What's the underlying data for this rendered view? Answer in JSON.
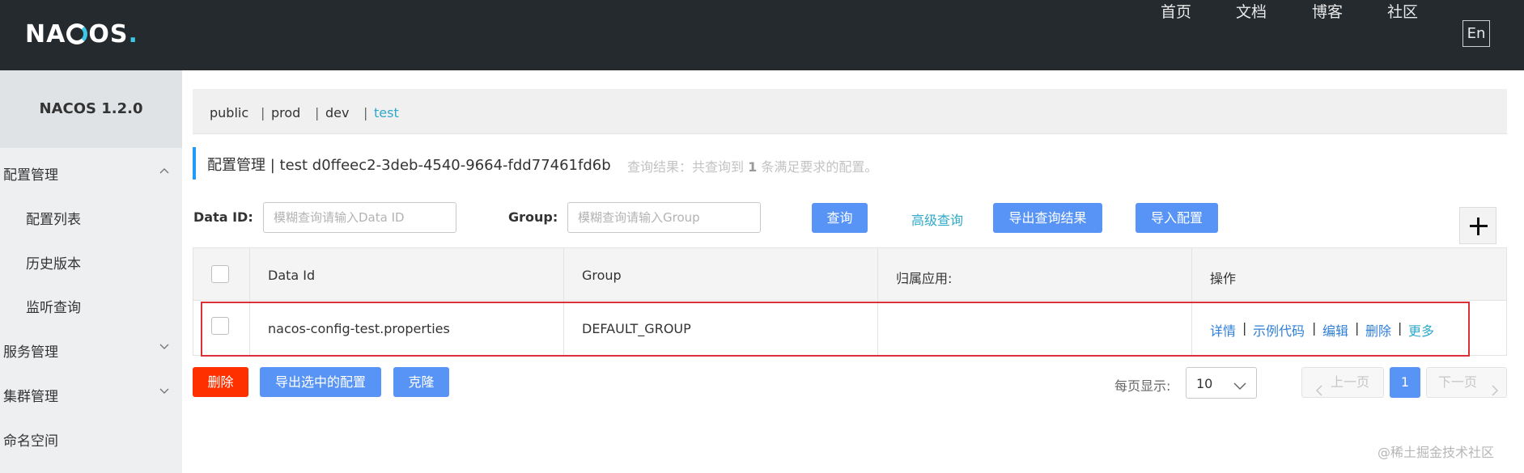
{
  "header": {
    "logo_text_left": "NA",
    "logo_text_right": "OS",
    "logo_dot": ".",
    "nav": [
      "首页",
      "文档",
      "博客",
      "社区"
    ],
    "lang": "En"
  },
  "sidebar": {
    "version": "NACOS 1.2.0",
    "menu": [
      {
        "label": "配置管理"
      },
      {
        "label": "配置列表"
      },
      {
        "label": "历史版本"
      },
      {
        "label": "监听查询"
      },
      {
        "label": "服务管理"
      },
      {
        "label": "集群管理"
      },
      {
        "label": "命名空间"
      }
    ]
  },
  "namespaces": {
    "items": [
      "public",
      "prod",
      "dev",
      "test"
    ],
    "separator": "|",
    "active": "test"
  },
  "title": {
    "text": "配置管理 | test d0ffeec2-3deb-4540-9664-fdd77461fd6b",
    "hint_prefix": "查询结果：共查询到",
    "hint_count": "1",
    "hint_suffix": "条满足要求的配置。"
  },
  "search": {
    "data_id_label": "Data ID:",
    "data_id_placeholder": "模糊查询请输入Data ID",
    "group_label": "Group:",
    "group_placeholder": "模糊查询请输入Group",
    "query_button": "查询",
    "advanced_query": "高级查询",
    "export_results": "导出查询结果",
    "import_config": "导入配置"
  },
  "table": {
    "headers": [
      "Data Id",
      "Group",
      "归属应用:",
      "操作"
    ],
    "rows": [
      {
        "data_id": "nacos-config-test.properties",
        "group": "DEFAULT_GROUP",
        "app": "",
        "actions": [
          "详情",
          "示例代码",
          "编辑",
          "删除",
          "更多"
        ]
      }
    ],
    "action_separator": "|"
  },
  "footer": {
    "delete_button": "删除",
    "export_selected": "导出选中的配置",
    "clone_button": "克隆",
    "page_size_label": "每页显示:",
    "page_size": "10",
    "prev": "上一页",
    "current_page": "1",
    "next": "下一页"
  },
  "watermark": "@稀土掘金技术社区",
  "colors": {
    "header_bg": "#252a2f",
    "accent": "#5894f5",
    "link": "#2fa9c9",
    "danger": "#ff3000",
    "highlight_border": "#d9303a"
  }
}
